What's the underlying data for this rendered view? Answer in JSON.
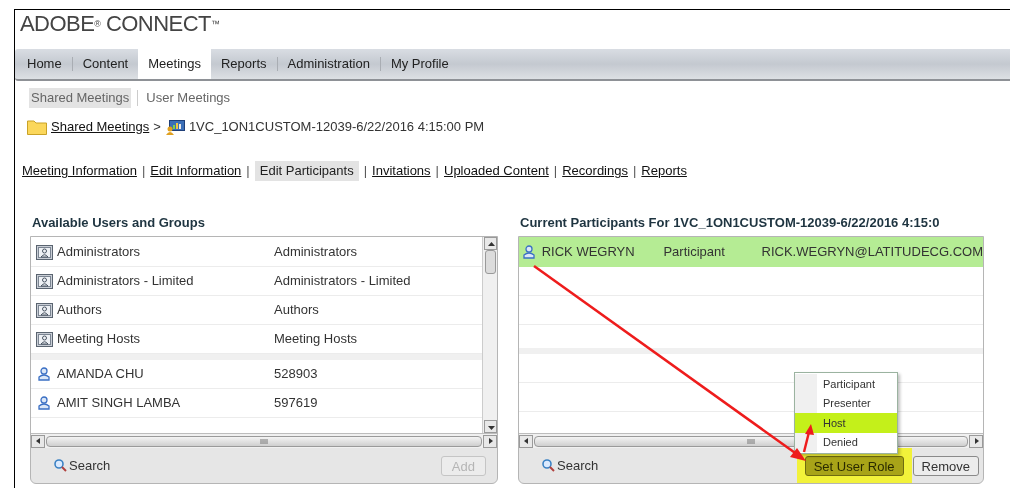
{
  "logo": "ADOBE$^{®}$ CONNECT$^{™}$",
  "nav_tabs": [
    {
      "label": "Home",
      "selected": false
    },
    {
      "label": "Content",
      "selected": false
    },
    {
      "label": "Meetings",
      "selected": true
    },
    {
      "label": "Reports",
      "selected": false
    },
    {
      "label": "Administration",
      "selected": false
    },
    {
      "label": "My Profile",
      "selected": false
    }
  ],
  "sub_tabs": [
    {
      "label": "Shared Meetings",
      "selected": true
    },
    {
      "label": "User Meetings",
      "selected": false
    }
  ],
  "breadcrumb": {
    "parent": "Shared Meetings",
    "separator": ">",
    "current": "1VC_1ON1CUSTOM-12039-6/22/2016 4:15:00 PM"
  },
  "meeting_links": {
    "separator": "|",
    "items": [
      {
        "label": "Meeting Information",
        "selected": false
      },
      {
        "label": "Edit Information",
        "selected": false
      },
      {
        "label": "Edit Participants",
        "selected": true
      },
      {
        "label": "Invitations",
        "selected": false
      },
      {
        "label": "Uploaded Content",
        "selected": false
      },
      {
        "label": "Recordings",
        "selected": false
      },
      {
        "label": "Reports",
        "selected": false
      }
    ]
  },
  "available_panel": {
    "title": "Available Users and Groups",
    "rows": [
      {
        "kind": "group",
        "name": "Administrators",
        "detail": "Administrators"
      },
      {
        "kind": "group",
        "name": "Administrators - Limited",
        "detail": "Administrators - Limited"
      },
      {
        "kind": "group",
        "name": "Authors",
        "detail": "Authors"
      },
      {
        "kind": "group",
        "name": "Meeting Hosts",
        "detail": "Meeting Hosts"
      },
      {
        "kind": "user",
        "name": "AMANDA CHU",
        "detail": "528903"
      },
      {
        "kind": "user",
        "name": "AMIT SINGH LAMBA",
        "detail": "597619"
      }
    ],
    "search": "Search",
    "add_button": {
      "label": "Add",
      "disabled": true
    }
  },
  "participants_panel": {
    "title": "Current Participants For 1VC_1ON1CUSTOM-12039-6/22/2016 4:15:0",
    "rows": [
      {
        "name": "RICK WEGRYN",
        "role": "Participant",
        "email": "RICK.WEGRYN@LATITUDECG.COM",
        "selected": true
      }
    ],
    "search": "Search",
    "buttons": [
      {
        "label": "Set User Role",
        "highlighted": true
      },
      {
        "label": "Remove",
        "highlighted": false
      }
    ],
    "role_menu": [
      {
        "label": "Participant",
        "selected": false
      },
      {
        "label": "Presenter",
        "selected": false
      },
      {
        "label": "Host",
        "selected": true
      },
      {
        "label": "Denied",
        "selected": false
      }
    ]
  }
}
